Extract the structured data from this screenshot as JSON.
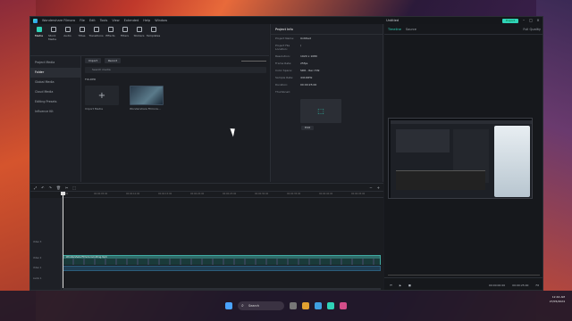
{
  "app": {
    "title": "Wondershare Filmora",
    "project_name": "Untitled",
    "menu": [
      "File",
      "Edit",
      "Tools",
      "View",
      "Extended",
      "Help",
      "Window"
    ],
    "export_label": "Export"
  },
  "toolbar": {
    "items": [
      "Media",
      "Stock Media",
      "Audio",
      "Titles",
      "Transitions",
      "Effects",
      "Filters",
      "Stickers",
      "Templates"
    ]
  },
  "sidebar": {
    "items": [
      "Project Media",
      "Folder",
      "Global Media",
      "Cloud Media",
      "Editing Presets",
      "Influence Kit"
    ]
  },
  "media": {
    "import_label": "Import",
    "record_label": "Record",
    "search_placeholder": "Search media",
    "folder_label": "FOLDER",
    "items": [
      {
        "label": "Import Media"
      },
      {
        "label": "Wondershare Filmora..."
      }
    ]
  },
  "info": {
    "header": "Project Info",
    "rows": [
      {
        "k": "Project Name:",
        "v": "Untitled"
      },
      {
        "k": "Project File Location:",
        "v": "/"
      },
      {
        "k": "Resolution:",
        "v": "1920 x 1080"
      },
      {
        "k": "Frame Rate:",
        "v": "25fps"
      },
      {
        "k": "Color Space:",
        "v": "SDR - Rec.709"
      },
      {
        "k": "Sample Rate:",
        "v": "44100Hz"
      },
      {
        "k": "Duration:",
        "v": "00:00:25:00"
      },
      {
        "k": "Thumbnail:",
        "v": ""
      }
    ],
    "edit_label": "Edit"
  },
  "preview": {
    "tabs": [
      "Timeline",
      "Source"
    ],
    "quality": "Full Quality",
    "timecode": "00:00:00:00",
    "duration": "00:00:25:00",
    "zoom": "Fit"
  },
  "timeline": {
    "ruler": [
      "00:00",
      "00:00:05:00",
      "00:00:10:00",
      "00:00:15:00",
      "00:00:20:00",
      "00:00:25:00",
      "00:00:30:00",
      "00:00:35:00",
      "00:00:40:00",
      "00:00:45:00"
    ],
    "tracks": [
      "Video 3",
      "Video 2",
      "Video 1",
      "Audio 1"
    ],
    "clip_name": "Wondershare Filmora recording.mp4"
  },
  "taskbar": {
    "search": "Search",
    "time": "12:44 AM",
    "date": "27/05/2024"
  }
}
